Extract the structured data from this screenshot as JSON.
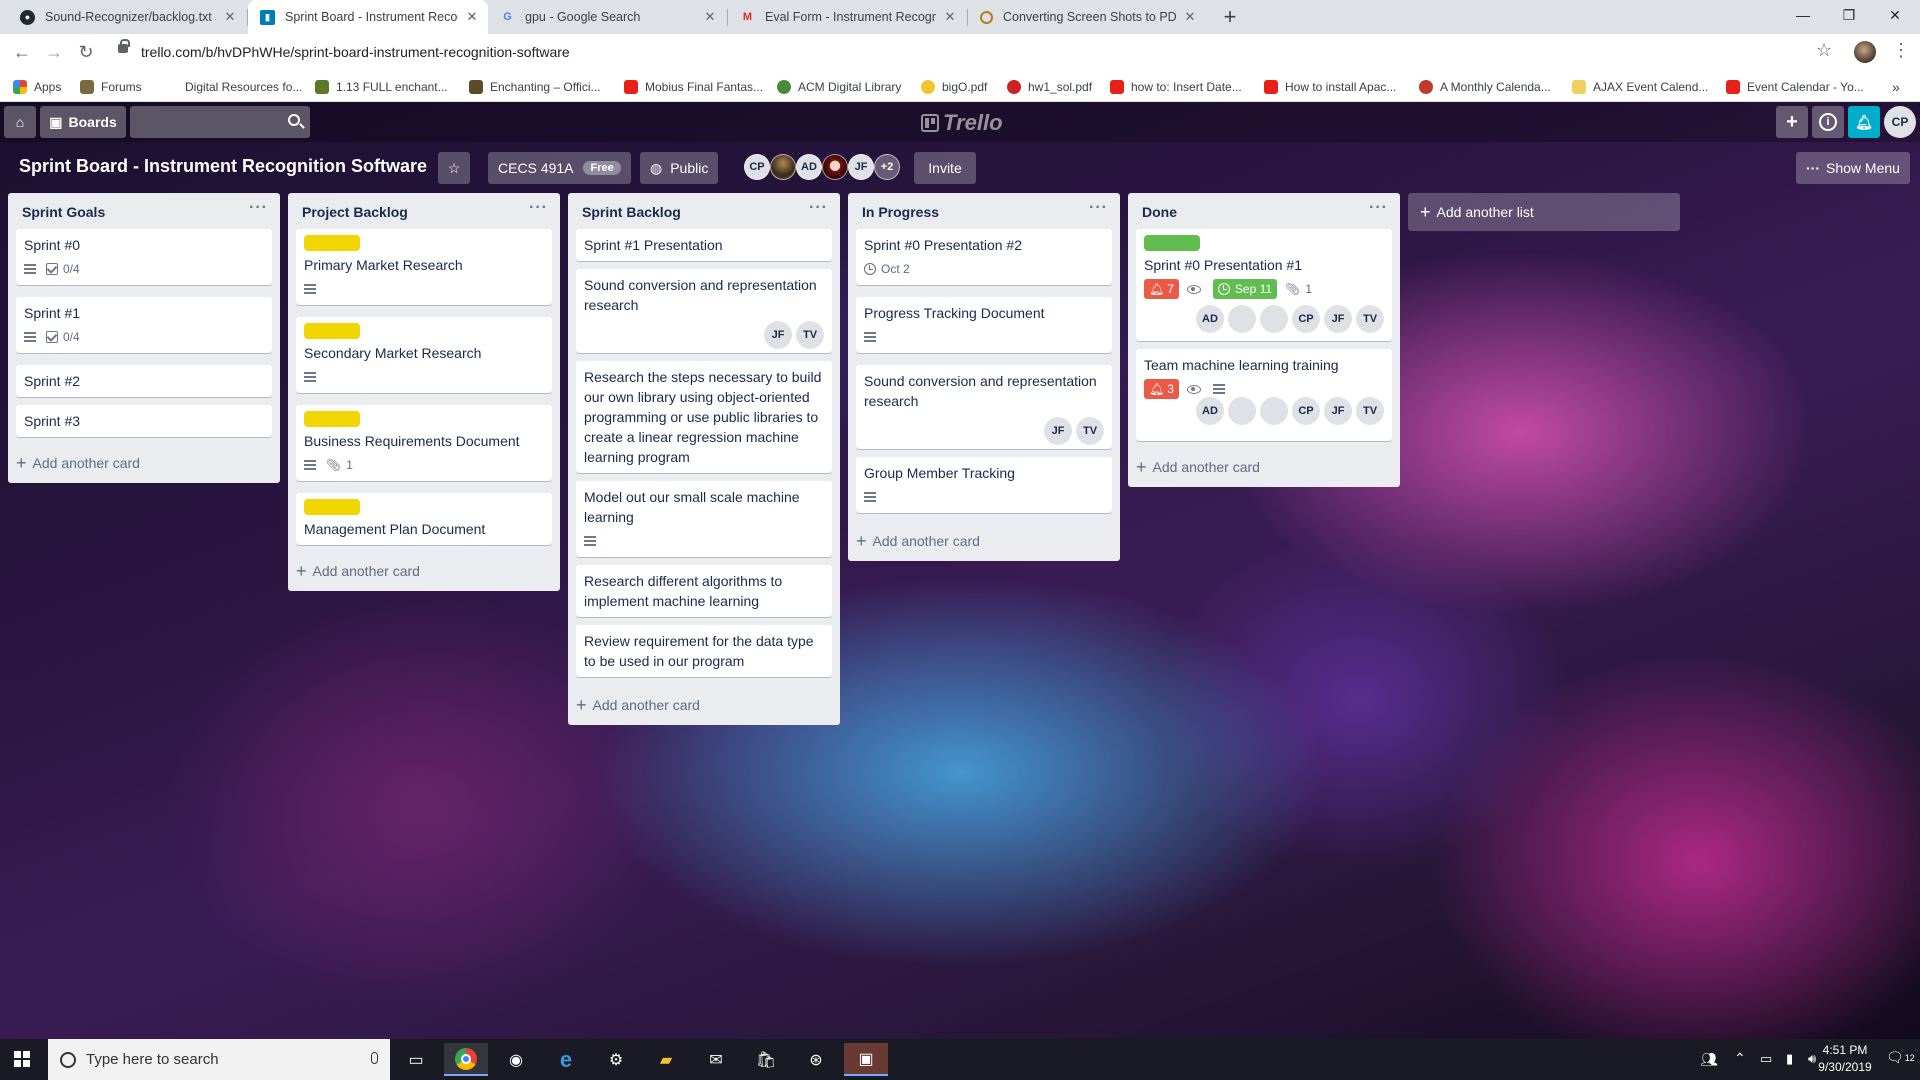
{
  "browser": {
    "tabs": [
      {
        "title": "Sound-Recognizer/backlog.txt at",
        "icon": "github-icon"
      },
      {
        "title": "Sprint Board - Instrument Recogn",
        "icon": "trello-icon"
      },
      {
        "title": "gpu - Google Search",
        "icon": "google-icon"
      },
      {
        "title": "Eval Form - Instrument Recognit",
        "icon": "gmail-icon"
      },
      {
        "title": "Converting Screen Shots to PDF",
        "icon": "page-icon"
      }
    ],
    "url": "trello.com/b/hvDPhWHe/sprint-board-instrument-recognition-software",
    "bookmarks": [
      {
        "label": "Apps",
        "color": "#ea4335"
      },
      {
        "label": "Forums",
        "color": "#7a6a40"
      },
      {
        "label": "Digital Resources fo...",
        "color": "#ffffff"
      },
      {
        "label": "1.13 FULL enchant...",
        "color": "#5a7a2a"
      },
      {
        "label": "Enchanting – Offici...",
        "color": "#5a4a2a"
      },
      {
        "label": "Mobius Final Fantas...",
        "color": "#e62117"
      },
      {
        "label": "ACM Digital Library",
        "color": "#4a8a3a"
      },
      {
        "label": "bigO.pdf",
        "color": "#f4c430"
      },
      {
        "label": "hw1_sol.pdf",
        "color": "#cc2222"
      },
      {
        "label": "how to: Insert Date...",
        "color": "#e62117"
      },
      {
        "label": "How to install Apac...",
        "color": "#e62117"
      },
      {
        "label": "A Monthly Calenda...",
        "color": "#c0392b"
      },
      {
        "label": "AJAX Event Calend...",
        "color": "#f0d060"
      },
      {
        "label": "Event Calendar - Yo...",
        "color": "#e62117"
      }
    ]
  },
  "trello": {
    "header": {
      "boards_label": "Boards",
      "logo": "Trello",
      "user_initials": "CP"
    },
    "board": {
      "title": "Sprint Board - Instrument Recognition Software",
      "team": "CECS 491A",
      "team_badge": "Free",
      "visibility": "Public",
      "members": [
        "CP",
        "",
        "AD",
        "",
        "JF"
      ],
      "more_members": "+2",
      "invite_label": "Invite",
      "show_menu_label": "Show Menu"
    },
    "add_card_label": "Add another card",
    "add_list_label": "Add another list",
    "lists": [
      {
        "title": "Sprint Goals",
        "cards": [
          {
            "title": "Sprint #0",
            "checklist": "0/4"
          },
          {
            "title": "Sprint #1",
            "checklist": "0/4"
          },
          {
            "title": "Sprint #2"
          },
          {
            "title": "Sprint #3"
          }
        ]
      },
      {
        "title": "Project Backlog",
        "cards": [
          {
            "title": "Primary Market Research",
            "label": "yellow"
          },
          {
            "title": "Secondary Market Research",
            "label": "yellow"
          },
          {
            "title": "Business Requirements Document",
            "label": "yellow",
            "attachments": "1"
          },
          {
            "title": "Management Plan Document",
            "label": "yellow"
          }
        ]
      },
      {
        "title": "Sprint Backlog",
        "cards": [
          {
            "title": "Sprint #1 Presentation"
          },
          {
            "title": "Sound conversion and representation research",
            "members": [
              "JF",
              "TV"
            ]
          },
          {
            "title": "Research the steps necessary to build our own library using object-oriented programming or use public libraries to create a linear regression machine learning program"
          },
          {
            "title": "Model out our small scale machine learning"
          },
          {
            "title": "Research different algorithms to implement machine learning"
          },
          {
            "title": "Review requirement for the data type to be used in our program"
          }
        ]
      },
      {
        "title": "In Progress",
        "cards": [
          {
            "title": "Sprint #0 Presentation #2",
            "due": "Oct 2"
          },
          {
            "title": "Progress Tracking Document"
          },
          {
            "title": "Sound conversion and representation research",
            "members": [
              "JF",
              "TV"
            ]
          },
          {
            "title": "Group Member Tracking"
          }
        ]
      },
      {
        "title": "Done",
        "cards": [
          {
            "title": "Sprint #0 Presentation #1",
            "label": "green",
            "notifications": "7",
            "due": "Sep 11",
            "attachments": "1",
            "members": [
              "AD",
              "",
              "",
              "CP",
              "JF",
              "TV"
            ]
          },
          {
            "title": "Team machine learning training",
            "notifications": "3",
            "members": [
              "AD",
              "",
              "",
              "CP",
              "JF",
              "TV"
            ]
          }
        ]
      }
    ]
  },
  "taskbar": {
    "search_placeholder": "Type here to search",
    "time": "4:51 PM",
    "date": "9/30/2019",
    "notification_count": "12"
  },
  "colors": {
    "label_yellow": "#f2d600",
    "label_green": "#61bd4f",
    "badge_red": "#eb5a46"
  }
}
